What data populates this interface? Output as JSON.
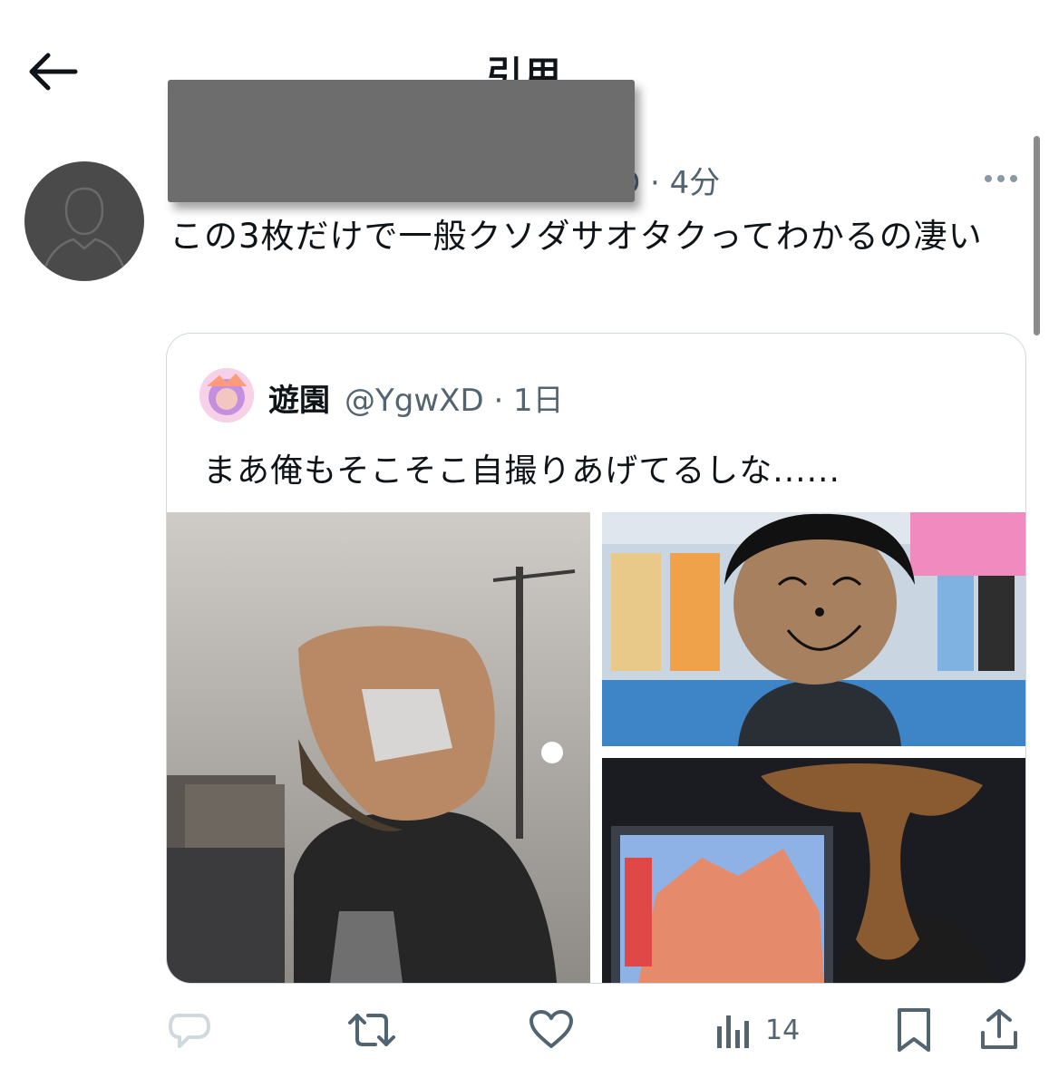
{
  "header": {
    "title": "引用"
  },
  "tweet": {
    "meta": "D · 4分",
    "text": "この3枚だけで一般クソダサオタクってわかるの凄い"
  },
  "quote": {
    "name": "遊園",
    "handle": "@YgwXD · 1日",
    "text": "まあ俺もそこそこ自撮りあげてるしな......"
  },
  "actions": {
    "views": "14"
  },
  "icons": [
    "back-arrow-icon",
    "more-icon",
    "reply-icon",
    "retweet-icon",
    "like-icon",
    "views-icon",
    "bookmark-icon",
    "share-icon"
  ]
}
